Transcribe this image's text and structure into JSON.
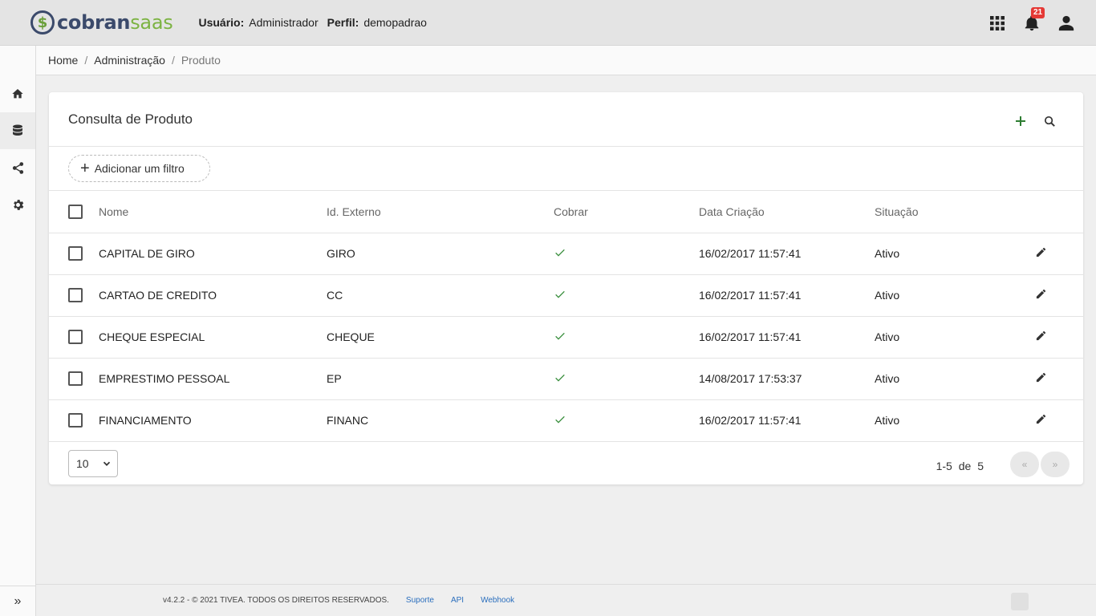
{
  "header": {
    "logo_mark": "$",
    "logo_text_a": "cobran",
    "logo_text_b": "saas",
    "user_label": "Usuário:",
    "user_value": "Administrador",
    "profile_label": "Perfil:",
    "profile_value": "demopadrao",
    "notification_count": "21"
  },
  "sidebar": {
    "items": [
      {
        "name": "home-icon"
      },
      {
        "name": "database-icon"
      },
      {
        "name": "share-icon"
      },
      {
        "name": "gear-icon"
      }
    ],
    "expand_label": "»"
  },
  "breadcrumb": {
    "items": [
      "Home",
      "Administração",
      "Produto"
    ],
    "separator": "/"
  },
  "card": {
    "title": "Consulta de Produto",
    "add_filter_label": "Adicionar um filtro"
  },
  "table": {
    "columns": [
      "Nome",
      "Id. Externo",
      "Cobrar",
      "Data Criação",
      "Situação"
    ],
    "rows": [
      {
        "nome": "CAPITAL DE GIRO",
        "id": "GIRO",
        "data": "16/02/2017 11:57:41",
        "situacao": "Ativo"
      },
      {
        "nome": "CARTAO DE CREDITO",
        "id": "CC",
        "data": "16/02/2017 11:57:41",
        "situacao": "Ativo"
      },
      {
        "nome": "CHEQUE ESPECIAL",
        "id": "CHEQUE",
        "data": "16/02/2017 11:57:41",
        "situacao": "Ativo"
      },
      {
        "nome": "EMPRESTIMO PESSOAL",
        "id": "EP",
        "data": "14/08/2017 17:53:37",
        "situacao": "Ativo"
      },
      {
        "nome": "FINANCIAMENTO",
        "id": "FINANC",
        "data": "16/02/2017 11:57:41",
        "situacao": "Ativo"
      }
    ]
  },
  "pagination": {
    "page_size": "10",
    "range": "1-5",
    "of_label": "de",
    "total": "5",
    "prev_label": "«",
    "next_label": "»"
  },
  "footer": {
    "copyright": "v4.2.2 - © 2021 TIVEA. TODOS OS DIREITOS RESERVADOS.",
    "links": [
      "Suporte",
      "API",
      "Webhook"
    ]
  },
  "colors": {
    "accent": "#2e7d32",
    "check": "#388e3c",
    "badge": "#e53935",
    "logo_dark": "#3b4a6b",
    "logo_green": "#7cb342"
  }
}
